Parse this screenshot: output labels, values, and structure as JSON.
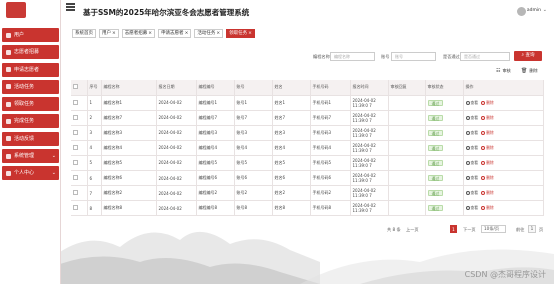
{
  "app": {
    "title": "基于SSM的2025年哈尔滨亚冬会志愿者管理系统",
    "user": "admin"
  },
  "sidebar": {
    "items": [
      {
        "label": "用户",
        "has_chevron": false
      },
      {
        "label": "志愿者招募",
        "has_chevron": false
      },
      {
        "label": "申请志愿者",
        "has_chevron": false
      },
      {
        "label": "活动任务",
        "has_chevron": false
      },
      {
        "label": "领取任务",
        "has_chevron": false
      },
      {
        "label": "完成任务",
        "has_chevron": false
      },
      {
        "label": "活动反馈",
        "has_chevron": false
      },
      {
        "label": "系统管理",
        "has_chevron": true
      },
      {
        "label": "个人中心",
        "has_chevron": true
      }
    ]
  },
  "tabs": [
    {
      "label": "系统首页",
      "closable": false,
      "active": false
    },
    {
      "label": "用户",
      "closable": true,
      "active": false
    },
    {
      "label": "志愿者招募",
      "closable": true,
      "active": false
    },
    {
      "label": "申请志愿者",
      "closable": true,
      "active": false
    },
    {
      "label": "活动任务",
      "closable": true,
      "active": false
    },
    {
      "label": "领取任务",
      "closable": true,
      "active": true
    }
  ],
  "search": {
    "field1_label": "编程名称",
    "field1_placeholder": "编程名称",
    "field2_label": "账号",
    "field2_placeholder": "账号",
    "field3_label": "是否通过",
    "field3_placeholder": "是否通过",
    "button": "查询"
  },
  "toolbar": {
    "review_label": "审核",
    "delete_label": "删除"
  },
  "table": {
    "headers": [
      "",
      "序号",
      "编程名称",
      "报名日期",
      "编程编号",
      "账号",
      "姓名",
      "手机号码",
      "报名时间",
      "审核回复",
      "审核状态",
      "操作"
    ],
    "rows": [
      {
        "no": "1",
        "name": "编程名称1",
        "date": "2024-04-02",
        "code": "编程编号1",
        "account": "账号1",
        "person": "姓名1",
        "phone": "手机号码1",
        "time": "2024-04-02 11:39:0 7",
        "reply": "",
        "status": "通过"
      },
      {
        "no": "2",
        "name": "编程名称7",
        "date": "2024-04-02",
        "code": "编程编号7",
        "account": "账号7",
        "person": "姓名7",
        "phone": "手机号码7",
        "time": "2024-04-02 11:39:0 7",
        "reply": "",
        "status": "通过"
      },
      {
        "no": "3",
        "name": "编程名称3",
        "date": "2024-04-02",
        "code": "编程编号3",
        "account": "账号3",
        "person": "姓名3",
        "phone": "手机号码3",
        "time": "2024-04-02 11:39:0 7",
        "reply": "",
        "status": "通过"
      },
      {
        "no": "4",
        "name": "编程名称4",
        "date": "2024-04-02",
        "code": "编程编号4",
        "account": "账号4",
        "person": "姓名4",
        "phone": "手机号码4",
        "time": "2024-04-02 11:39:0 7",
        "reply": "",
        "status": "通过"
      },
      {
        "no": "5",
        "name": "编程名称5",
        "date": "2024-04-02",
        "code": "编程编号5",
        "account": "账号5",
        "person": "姓名5",
        "phone": "手机号码5",
        "time": "2024-04-02 11:39:0 7",
        "reply": "",
        "status": "通过"
      },
      {
        "no": "6",
        "name": "编程名称6",
        "date": "2024-04-02",
        "code": "编程编号6",
        "account": "账号6",
        "person": "姓名6",
        "phone": "手机号码6",
        "time": "2024-04-02 11:39:0 7",
        "reply": "",
        "status": "通过"
      },
      {
        "no": "7",
        "name": "编程名称2",
        "date": "2024-04-02",
        "code": "编程编号2",
        "account": "账号2",
        "person": "姓名2",
        "phone": "手机号码2",
        "time": "2024-04-02 11:39:0 7",
        "reply": "",
        "status": "通过"
      },
      {
        "no": "8",
        "name": "编程名称8",
        "date": "2024-04-02",
        "code": "编程编号8",
        "account": "账号8",
        "person": "姓名8",
        "phone": "手机号码8",
        "time": "2024-04-02 11:39:0 7",
        "reply": "",
        "status": "通过"
      }
    ],
    "actions": {
      "view": "查看",
      "delete": "删除"
    }
  },
  "pager": {
    "total": "共 8 条",
    "prev": "上一页",
    "current_page": "1",
    "next": "下一页",
    "page_size": "10条/页",
    "goto_label": "前往",
    "goto_value": "1",
    "page_unit": "页"
  },
  "watermark": "CSDN @杰哥程序设计",
  "colors": {
    "accent": "#c9342f",
    "status_pass_bg": "#e7f4e1",
    "status_pass_text": "#5b9a45"
  }
}
